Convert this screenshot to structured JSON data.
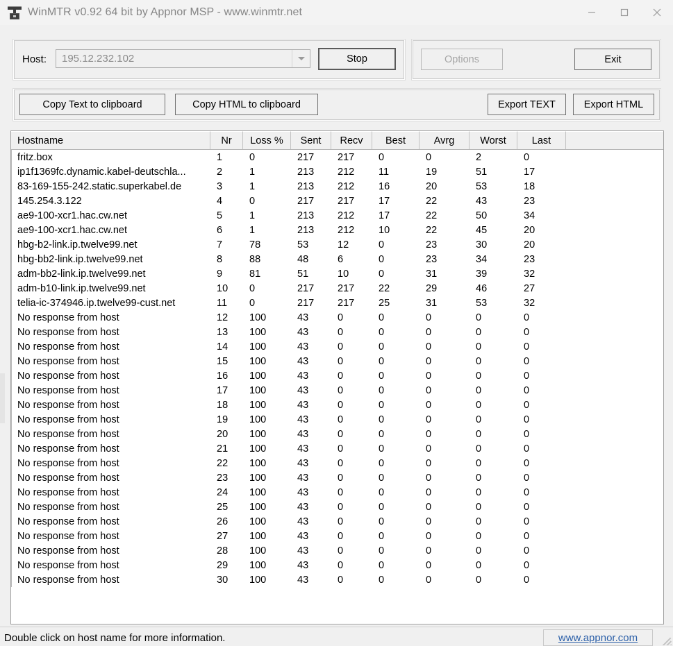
{
  "window": {
    "title": "WinMTR v0.92 64 bit by Appnor MSP - www.winmtr.net",
    "icon": "network-tower-icon",
    "minimize_label": "—",
    "maximize_label": "□",
    "close_label": "✕"
  },
  "toolbar": {
    "host_label": "Host:",
    "host_value": "195.12.232.102",
    "host_placeholder": "195.12.232.102",
    "stop_label": "Stop",
    "options_label": "Options",
    "options_disabled": true,
    "exit_label": "Exit",
    "copy_text_label": "Copy Text to clipboard",
    "copy_html_label": "Copy HTML to clipboard",
    "export_text_label": "Export TEXT",
    "export_html_label": "Export HTML"
  },
  "table": {
    "columns": [
      "Hostname",
      "Nr",
      "Loss %",
      "Sent",
      "Recv",
      "Best",
      "Avrg",
      "Worst",
      "Last"
    ],
    "rows": [
      [
        "fritz.box",
        "1",
        "0",
        "217",
        "217",
        "0",
        "0",
        "2",
        "0"
      ],
      [
        "ip1f1369fc.dynamic.kabel-deutschla...",
        "2",
        "1",
        "213",
        "212",
        "11",
        "19",
        "51",
        "17"
      ],
      [
        "83-169-155-242.static.superkabel.de",
        "3",
        "1",
        "213",
        "212",
        "16",
        "20",
        "53",
        "18"
      ],
      [
        "145.254.3.122",
        "4",
        "0",
        "217",
        "217",
        "17",
        "22",
        "43",
        "23"
      ],
      [
        "ae9-100-xcr1.hac.cw.net",
        "5",
        "1",
        "213",
        "212",
        "17",
        "22",
        "50",
        "34"
      ],
      [
        "ae9-100-xcr1.hac.cw.net",
        "6",
        "1",
        "213",
        "212",
        "10",
        "22",
        "45",
        "20"
      ],
      [
        "hbg-b2-link.ip.twelve99.net",
        "7",
        "78",
        "53",
        "12",
        "0",
        "23",
        "30",
        "20"
      ],
      [
        "hbg-bb2-link.ip.twelve99.net",
        "8",
        "88",
        "48",
        "6",
        "0",
        "23",
        "34",
        "23"
      ],
      [
        "adm-bb2-link.ip.twelve99.net",
        "9",
        "81",
        "51",
        "10",
        "0",
        "31",
        "39",
        "32"
      ],
      [
        "adm-b10-link.ip.twelve99.net",
        "10",
        "0",
        "217",
        "217",
        "22",
        "29",
        "46",
        "27"
      ],
      [
        "telia-ic-374946.ip.twelve99-cust.net",
        "11",
        "0",
        "217",
        "217",
        "25",
        "31",
        "53",
        "32"
      ],
      [
        "No response from host",
        "12",
        "100",
        "43",
        "0",
        "0",
        "0",
        "0",
        "0"
      ],
      [
        "No response from host",
        "13",
        "100",
        "43",
        "0",
        "0",
        "0",
        "0",
        "0"
      ],
      [
        "No response from host",
        "14",
        "100",
        "43",
        "0",
        "0",
        "0",
        "0",
        "0"
      ],
      [
        "No response from host",
        "15",
        "100",
        "43",
        "0",
        "0",
        "0",
        "0",
        "0"
      ],
      [
        "No response from host",
        "16",
        "100",
        "43",
        "0",
        "0",
        "0",
        "0",
        "0"
      ],
      [
        "No response from host",
        "17",
        "100",
        "43",
        "0",
        "0",
        "0",
        "0",
        "0"
      ],
      [
        "No response from host",
        "18",
        "100",
        "43",
        "0",
        "0",
        "0",
        "0",
        "0"
      ],
      [
        "No response from host",
        "19",
        "100",
        "43",
        "0",
        "0",
        "0",
        "0",
        "0"
      ],
      [
        "No response from host",
        "20",
        "100",
        "43",
        "0",
        "0",
        "0",
        "0",
        "0"
      ],
      [
        "No response from host",
        "21",
        "100",
        "43",
        "0",
        "0",
        "0",
        "0",
        "0"
      ],
      [
        "No response from host",
        "22",
        "100",
        "43",
        "0",
        "0",
        "0",
        "0",
        "0"
      ],
      [
        "No response from host",
        "23",
        "100",
        "43",
        "0",
        "0",
        "0",
        "0",
        "0"
      ],
      [
        "No response from host",
        "24",
        "100",
        "43",
        "0",
        "0",
        "0",
        "0",
        "0"
      ],
      [
        "No response from host",
        "25",
        "100",
        "43",
        "0",
        "0",
        "0",
        "0",
        "0"
      ],
      [
        "No response from host",
        "26",
        "100",
        "43",
        "0",
        "0",
        "0",
        "0",
        "0"
      ],
      [
        "No response from host",
        "27",
        "100",
        "43",
        "0",
        "0",
        "0",
        "0",
        "0"
      ],
      [
        "No response from host",
        "28",
        "100",
        "43",
        "0",
        "0",
        "0",
        "0",
        "0"
      ],
      [
        "No response from host",
        "29",
        "100",
        "43",
        "0",
        "0",
        "0",
        "0",
        "0"
      ],
      [
        "No response from host",
        "30",
        "100",
        "43",
        "0",
        "0",
        "0",
        "0",
        "0"
      ]
    ]
  },
  "statusbar": {
    "hint": "Double click on host name for more information.",
    "link": "www.appnor.com"
  },
  "colors": {
    "window_bg": "#f0f0f0",
    "list_bg": "#ffffff",
    "title_text": "#868686",
    "disabled_text": "#a6a6a6",
    "link": "#2b5fa8"
  }
}
